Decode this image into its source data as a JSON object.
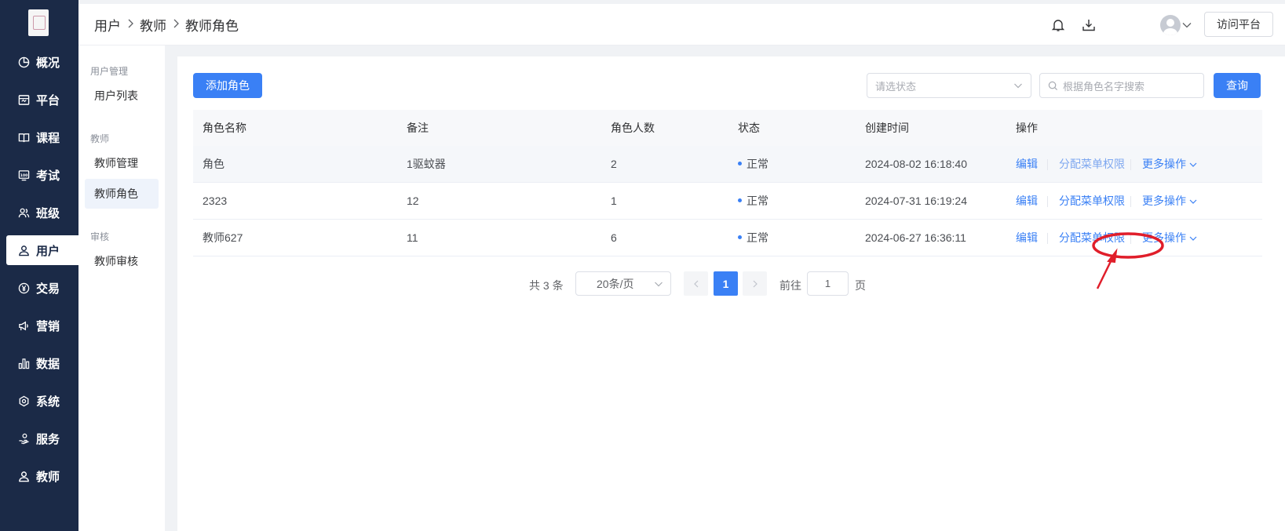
{
  "nav": {
    "items": [
      {
        "label": "概况",
        "icon": "pie-chart-icon"
      },
      {
        "label": "平台",
        "icon": "store-icon"
      },
      {
        "label": "课程",
        "icon": "book-icon"
      },
      {
        "label": "考试",
        "icon": "exam-icon"
      },
      {
        "label": "班级",
        "icon": "group-icon"
      },
      {
        "label": "用户",
        "icon": "user-icon",
        "active": true
      },
      {
        "label": "交易",
        "icon": "yen-icon"
      },
      {
        "label": "营销",
        "icon": "megaphone-icon"
      },
      {
        "label": "数据",
        "icon": "bar-chart-icon"
      },
      {
        "label": "系统",
        "icon": "gear-icon"
      },
      {
        "label": "服务",
        "icon": "hand-service-icon"
      },
      {
        "label": "教师",
        "icon": "teacher-icon"
      }
    ]
  },
  "subnav": {
    "group1": "用户管理",
    "item_user_list": "用户列表",
    "group2": "教师",
    "item_teacher_manage": "教师管理",
    "item_teacher_role": "教师角色",
    "group3": "审核",
    "item_teacher_review": "教师审核"
  },
  "header": {
    "breadcrumb": [
      "用户",
      "教师",
      "教师角色"
    ],
    "visit_btn": "访问平台"
  },
  "toolbar": {
    "add_role": "添加角色",
    "status_placeholder": "请选状态",
    "search_placeholder": "根据角色名字搜索",
    "query": "查询"
  },
  "table": {
    "headers": [
      "角色名称",
      "备注",
      "角色人数",
      "状态",
      "创建时间",
      "操作"
    ],
    "rows": [
      {
        "name": "角色",
        "note": "1驱蚊器",
        "count": "2",
        "status": "正常",
        "created": "2024-08-02 16:18:40"
      },
      {
        "name": "2323",
        "note": "12",
        "count": "1",
        "status": "正常",
        "created": "2024-07-31 16:19:24"
      },
      {
        "name": "教师627",
        "note": "11",
        "count": "6",
        "status": "正常",
        "created": "2024-06-27 16:36:11"
      }
    ],
    "op_edit": "编辑",
    "op_assign": "分配菜单权限",
    "op_more": "更多操作"
  },
  "pagination": {
    "total": "共 3 条",
    "page_size": "20条/页",
    "current_page": "1",
    "goto_label": "前往",
    "goto_value": "1",
    "goto_suffix": "页"
  },
  "colors": {
    "nav_bg": "#1b2a47",
    "primary": "#3a80f5",
    "annotation": "#e01e2a"
  }
}
